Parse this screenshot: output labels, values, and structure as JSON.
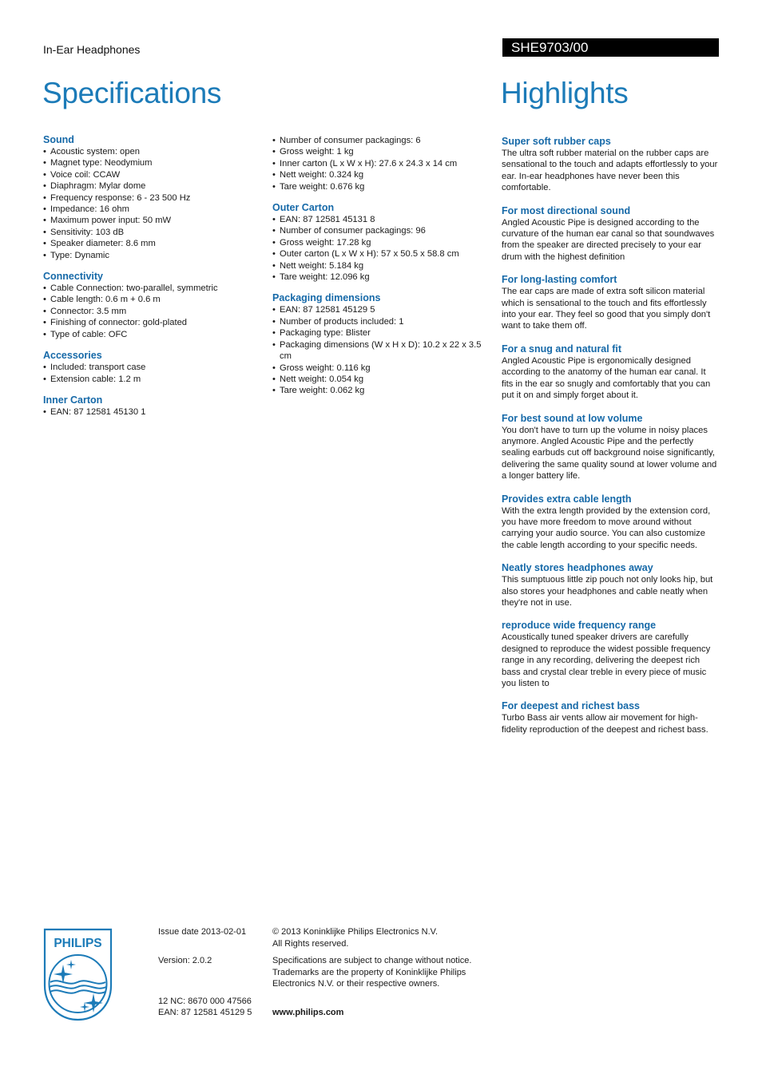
{
  "header": {
    "category": "In-Ear Headphones",
    "model": "SHE9703/00",
    "specifications_title": "Specifications",
    "highlights_title": "Highlights"
  },
  "colors": {
    "accent": "#1c7bb8",
    "heading": "#1669a8",
    "model_bar": "#000000"
  },
  "specifications": {
    "column1": [
      {
        "heading": "Sound",
        "items": [
          "Acoustic system: open",
          "Magnet type: Neodymium",
          "Voice coil: CCAW",
          "Diaphragm: Mylar dome",
          "Frequency response: 6 - 23 500 Hz",
          "Impedance: 16 ohm",
          "Maximum power input: 50 mW",
          "Sensitivity: 103 dB",
          "Speaker diameter: 8.6 mm",
          "Type: Dynamic"
        ]
      },
      {
        "heading": "Connectivity",
        "items": [
          "Cable Connection: two-parallel, symmetric",
          "Cable length: 0.6 m + 0.6 m",
          "Connector: 3.5 mm",
          "Finishing of connector: gold-plated",
          "Type of cable: OFC"
        ]
      },
      {
        "heading": "Accessories",
        "items": [
          "Included: transport case",
          "Extension cable: 1.2 m"
        ]
      },
      {
        "heading": "Inner Carton",
        "items": [
          "EAN: 87 12581 45130 1"
        ]
      }
    ],
    "column2": [
      {
        "heading": "",
        "items": [
          "Number of consumer packagings: 6",
          "Gross weight: 1 kg",
          "Inner carton (L x W x H): 27.6 x 24.3 x 14 cm",
          "Nett weight: 0.324 kg",
          "Tare weight: 0.676 kg"
        ]
      },
      {
        "heading": "Outer Carton",
        "items": [
          "EAN: 87 12581 45131 8",
          "Number of consumer packagings: 96",
          "Gross weight: 17.28 kg",
          "Outer carton (L x W x H): 57 x 50.5 x 58.8 cm",
          "Nett weight: 5.184 kg",
          "Tare weight: 12.096 kg"
        ]
      },
      {
        "heading": "Packaging dimensions",
        "items": [
          "EAN: 87 12581 45129 5",
          "Number of products included: 1",
          "Packaging type: Blister",
          "Packaging dimensions (W x H x D): 10.2 x 22 x 3.5 cm",
          "Gross weight: 0.116 kg",
          "Nett weight: 0.054 kg",
          "Tare weight: 0.062 kg"
        ]
      }
    ]
  },
  "highlights": [
    {
      "heading": "Super soft rubber caps",
      "text": "The ultra soft rubber material on the rubber caps are sensational to the touch and adapts effortlessly to your ear. In-ear headphones have never been this comfortable."
    },
    {
      "heading": "For most directional sound",
      "text": "Angled Acoustic Pipe is designed according to the curvature of the human ear canal so that soundwaves from the speaker are directed precisely to your ear drum with the highest definition"
    },
    {
      "heading": "For long-lasting comfort",
      "text": "The ear caps are made of extra soft silicon material which is sensational to the touch and fits effortlessly into your ear. They feel so good that you simply don't want to take them off."
    },
    {
      "heading": "For a snug and natural fit",
      "text": "Angled Acoustic Pipe is ergonomically designed according to the anatomy of the human ear canal. It fits in the ear so snugly and comfortably that you can put it on and simply forget about it."
    },
    {
      "heading": "For best sound at low volume",
      "text": "You don't have to turn up the volume in noisy places anymore. Angled Acoustic Pipe and the perfectly sealing earbuds cut off background noise significantly, delivering the same quality sound at lower volume and a longer battery life."
    },
    {
      "heading": "Provides extra cable length",
      "text": "With the extra length provided by the extension cord, you have more freedom to move around without carrying your audio source. You can also customize the cable length according to your specific needs."
    },
    {
      "heading": "Neatly stores headphones away",
      "text": "This sumptuous little zip pouch not only looks hip, but also stores your headphones and cable neatly when they're not in use."
    },
    {
      "heading": "reproduce wide frequency range",
      "text": "Acoustically tuned speaker drivers are carefully designed to reproduce the widest possible frequency range in any recording, delivering the deepest rich bass and crystal clear treble in every piece of music you listen to"
    },
    {
      "heading": "For deepest and richest bass",
      "text": "Turbo Bass air vents allow air movement for high-fidelity reproduction of the deepest and richest bass."
    }
  ],
  "footer": {
    "logo_text": "PHILIPS",
    "logo_icon": "philips-shield-logo",
    "issue_date": "Issue date 2013-02-01",
    "version": "Version: 2.0.2",
    "nc": "12 NC: 8670 000 47566",
    "ean": "EAN: 87 12581 45129 5",
    "copyright_line1": "© 2013 Koninklijke Philips Electronics N.V.",
    "copyright_line2": "All Rights reserved.",
    "notice_line1": "Specifications are subject to change without notice.",
    "notice_line2": "Trademarks are the property of Koninklijke Philips",
    "notice_line3": "Electronics N.V. or their respective owners.",
    "website": "www.philips.com"
  }
}
